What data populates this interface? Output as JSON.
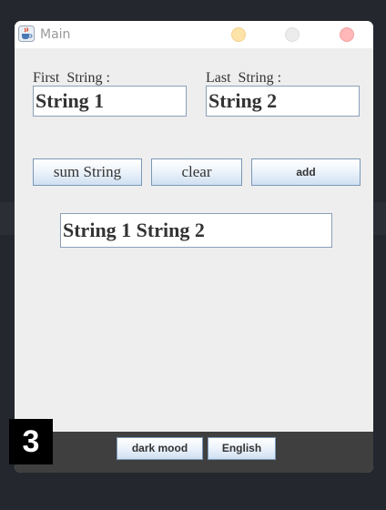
{
  "window": {
    "title": "Main"
  },
  "form": {
    "first_label": "First  String :",
    "last_label": "Last  String :",
    "first_value": "String 1",
    "last_value": "String 2"
  },
  "actions": {
    "sum_label": "sum String",
    "clear_label": "clear",
    "add_label": "add"
  },
  "result": {
    "value": "String 1 String 2"
  },
  "bottom": {
    "dark_mode_label": "dark mood",
    "language_label": "English"
  },
  "badge": {
    "number": "3"
  },
  "icons": {
    "app_icon": "java-cup-icon"
  },
  "colors": {
    "traffic_minimize": "#fde3a7",
    "traffic_maximize": "#ececec",
    "traffic_close": "#ffb7b7",
    "bottom_bar": "#3f3f3f",
    "button_border": "#7a98b8"
  }
}
